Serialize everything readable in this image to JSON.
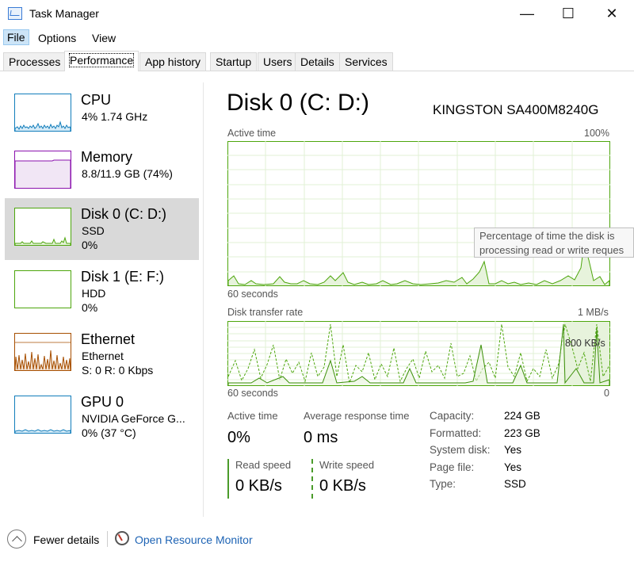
{
  "window": {
    "title": "Task Manager",
    "minimize_glyph": "—",
    "maximize_glyph": "☐",
    "close_glyph": "✕"
  },
  "menu": {
    "file": "File",
    "options": "Options",
    "view": "View"
  },
  "tabs": [
    {
      "label": "Processes"
    },
    {
      "label": "Performance",
      "active": true
    },
    {
      "label": "App history"
    },
    {
      "label": "Startup"
    },
    {
      "label": "Users"
    },
    {
      "label": "Details"
    },
    {
      "label": "Services"
    }
  ],
  "sidebar": {
    "items": [
      {
        "name": "CPU",
        "sub1": "4%  1.74 GHz",
        "sub2": "",
        "sub3": "",
        "color": "#117dbb"
      },
      {
        "name": "Memory",
        "sub1": "8.8/11.9 GB (74%)",
        "sub2": "",
        "sub3": "",
        "color": "#8b12ae"
      },
      {
        "name": "Disk 0 (C: D:)",
        "sub1": "SSD",
        "sub2": "0%",
        "sub3": "",
        "color": "#4da60c",
        "selected": true
      },
      {
        "name": "Disk 1 (E: F:)",
        "sub1": "HDD",
        "sub2": "0%",
        "sub3": "",
        "color": "#4da60c"
      },
      {
        "name": "Ethernet",
        "sub1": "Ethernet",
        "sub2": "S: 0  R: 0 Kbps",
        "sub3": "",
        "color": "#a74f01"
      },
      {
        "name": "GPU 0",
        "sub1": "NVIDIA GeForce G...",
        "sub2": "0%  (37 °C)",
        "sub3": "",
        "color": "#117dbb"
      }
    ]
  },
  "main": {
    "title": "Disk 0 (C: D:)",
    "model": "KINGSTON SA400M8240G",
    "active_time_graph": {
      "label": "Active time",
      "max_label": "100%",
      "time_label": "60 seconds",
      "min_label": ""
    },
    "transfer_graph": {
      "label": "Disk transfer rate",
      "max_label": "1 MB/s",
      "time_label": "60 seconds",
      "min_label": "0",
      "mid_label": "800 KB/s"
    },
    "tooltip": {
      "line1": "Percentage of time the disk is",
      "line2": "processing read or write reques"
    },
    "stats": {
      "active_time_label": "Active time",
      "active_time_value": "0%",
      "avg_response_label": "Average response time",
      "avg_response_value": "0 ms",
      "read_speed_label": "Read speed",
      "read_speed_value": "0 KB/s",
      "write_speed_label": "Write speed",
      "write_speed_value": "0 KB/s"
    },
    "info": [
      {
        "key": "Capacity:",
        "value": "224 GB"
      },
      {
        "key": "Formatted:",
        "value": "223 GB"
      },
      {
        "key": "System disk:",
        "value": "Yes"
      },
      {
        "key": "Page file:",
        "value": "Yes"
      },
      {
        "key": "Type:",
        "value": "SSD"
      }
    ],
    "accent": "#4da60c"
  },
  "footer": {
    "fewer_details": "Fewer details",
    "open_resource_monitor": "Open Resource Monitor"
  }
}
